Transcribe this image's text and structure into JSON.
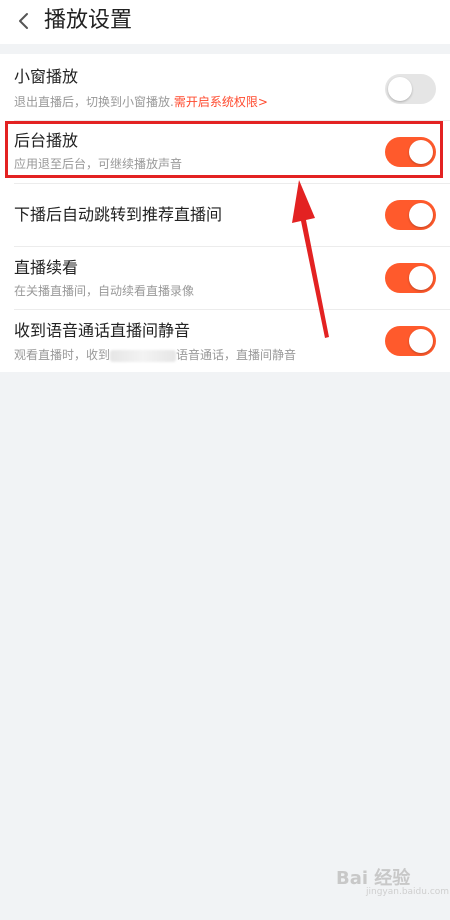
{
  "header": {
    "title": "播放设置",
    "back_icon": "chevron-left-icon"
  },
  "settings": [
    {
      "title": "小窗播放",
      "subtitle": "退出直播后，切换到小窗播放.",
      "link": "需开启系统权限>",
      "enabled": false
    },
    {
      "title": "后台播放",
      "subtitle": "应用退至后台，可继续播放声音",
      "enabled": true
    },
    {
      "title": "下播后自动跳转到推荐直播间",
      "enabled": true
    },
    {
      "title": "直播续看",
      "subtitle": "在关播直播间，自动续看直播录像",
      "enabled": true
    },
    {
      "title": "收到语音通话直播间静音",
      "subtitle_prefix": "观看直播时，收到",
      "subtitle_suffix": "语音通话，直播间静音",
      "enabled": true
    }
  ],
  "colors": {
    "accent": "#ff5a2c",
    "highlight": "#e32222",
    "background": "#f1f3f5"
  },
  "watermark": {
    "text": "Bai 经验",
    "sub": "jingyan.baidu.com"
  }
}
